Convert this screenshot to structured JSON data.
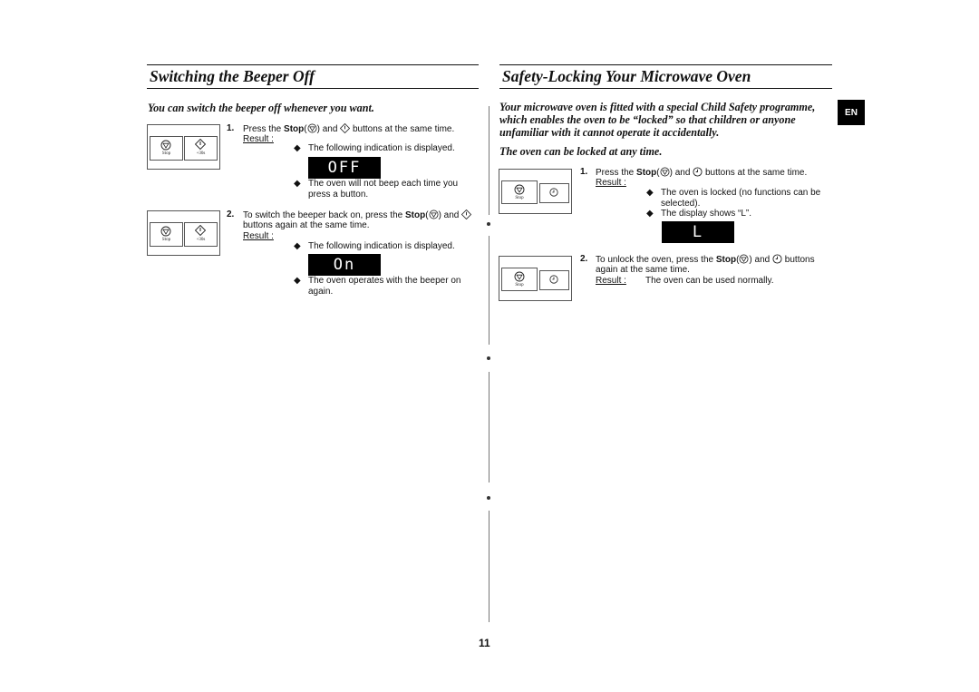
{
  "left_section": {
    "title": "Switching the Beeper Off",
    "intro": "You can switch the beeper off whenever you want.",
    "steps": [
      {
        "number": "1.",
        "text_before": "Press the ",
        "stop_label": "Stop",
        "text_after_stop": " and ",
        "text_end": " buttons at the same time.",
        "result_label": "Result :",
        "bullets": [
          "The following indication is displayed.",
          "The oven will not beep each time you press a button."
        ],
        "display": "OFF",
        "panel": {
          "left_button": "Stop",
          "right_button": "+30s"
        }
      },
      {
        "number": "2.",
        "text_before": "To switch the beeper back on, press the ",
        "stop_label": "Stop",
        "text_after_stop": " and ",
        "text_end": "buttons again at the same time.",
        "result_label": "Result :",
        "bullets": [
          "The following indication is displayed.",
          "The oven operates with the beeper on again."
        ],
        "display": "On",
        "panel": {
          "left_button": "Stop",
          "right_button": "+30s"
        }
      }
    ]
  },
  "right_section": {
    "title": "Safety-Locking Your Microwave Oven",
    "intro_lines": [
      "Your microwave oven is fitted with a special Child Safety programme,",
      "which enables the oven to be “locked” so that children or anyone",
      "unfamiliar with it cannot operate it accidentally."
    ],
    "intro2": "The oven can be locked at any time.",
    "steps": [
      {
        "number": "1.",
        "text_before": "Press the ",
        "stop_label": "Stop",
        "text_after_stop": " and ",
        "text_end": " buttons at the same time.",
        "result_label": "Result :",
        "bullets": [
          "The oven is locked (no functions can be selected).",
          "The display shows “L”."
        ],
        "display": "L",
        "panel": {
          "left_button": "Stop",
          "right_button": ""
        }
      },
      {
        "number": "2.",
        "text_before": "To unlock the oven, press the ",
        "stop_label": "Stop",
        "text_after_stop": " and ",
        "text_end": " buttons",
        "line2": "again at the same time.",
        "result_label": "Result :",
        "result_text": "The oven can be used normally.",
        "panel": {
          "left_button": "Stop",
          "right_button": ""
        }
      }
    ]
  },
  "language_tab": "EN",
  "page_number": "11",
  "icons": {
    "stop": "stop-icon",
    "start": "start-plus30s-icon",
    "clock": "clock-icon",
    "bullet": "diamond-bullet-icon"
  }
}
